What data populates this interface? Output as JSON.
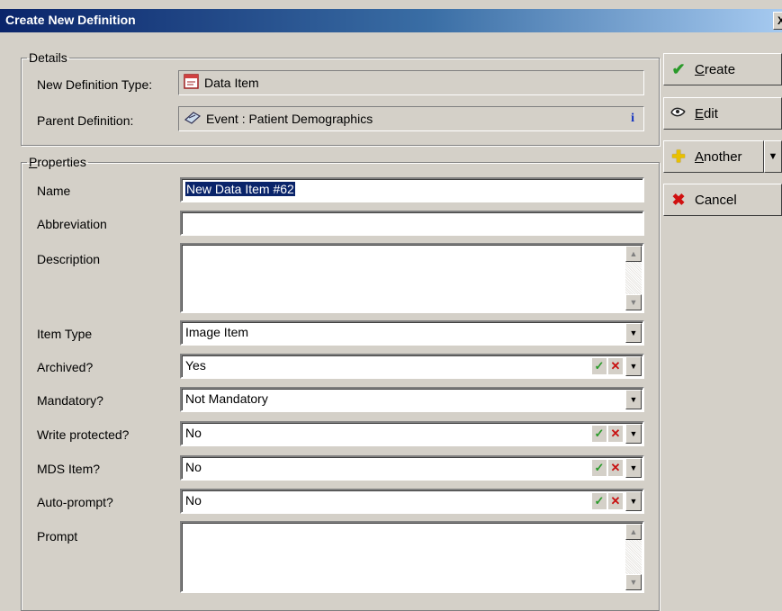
{
  "window": {
    "title": "Create New Definition",
    "close_glyph": "X"
  },
  "details": {
    "legend": "Details",
    "type_label": "New Definition Type:",
    "type_value": "Data Item",
    "parent_label": "Parent Definition:",
    "parent_value": "Event : Patient Demographics",
    "info_glyph": "i"
  },
  "properties": {
    "legend_first": "P",
    "legend_rest": "roperties",
    "name": {
      "label": "Name",
      "value": "New Data Item #62"
    },
    "abbreviation": {
      "label": "Abbreviation",
      "value": ""
    },
    "description": {
      "label": "Description",
      "value": ""
    },
    "item_type": {
      "label": "Item Type",
      "value": "Image Item"
    },
    "archived": {
      "label": "Archived?",
      "value": "Yes"
    },
    "mandatory": {
      "label": "Mandatory?",
      "value": "Not Mandatory"
    },
    "write_protected": {
      "label": "Write protected?",
      "value": "No"
    },
    "mds_item": {
      "label": "MDS Item?",
      "value": "No"
    },
    "auto_prompt": {
      "label": "Auto-prompt?",
      "value": "No"
    },
    "prompt": {
      "label": "Prompt",
      "value": ""
    }
  },
  "buttons": {
    "create": {
      "first": "C",
      "rest": "reate",
      "icon": "green-checkmark-icon"
    },
    "edit": {
      "first": "E",
      "rest": "dit",
      "icon": "pencil-icon"
    },
    "another": {
      "first": "A",
      "rest": "nother",
      "icon": "yellow-plus-icon"
    },
    "cancel": {
      "label": "Cancel",
      "icon": "red-x-icon"
    }
  },
  "glyphs": {
    "tick": "✓",
    "cross": "✕",
    "arrow_down": "▼",
    "arrow_up": "▲"
  },
  "colors": {
    "title_start": "#0a246a",
    "title_end": "#a6caf0",
    "dialog_bg": "#d4d0c8",
    "selection": "#0a246a"
  }
}
